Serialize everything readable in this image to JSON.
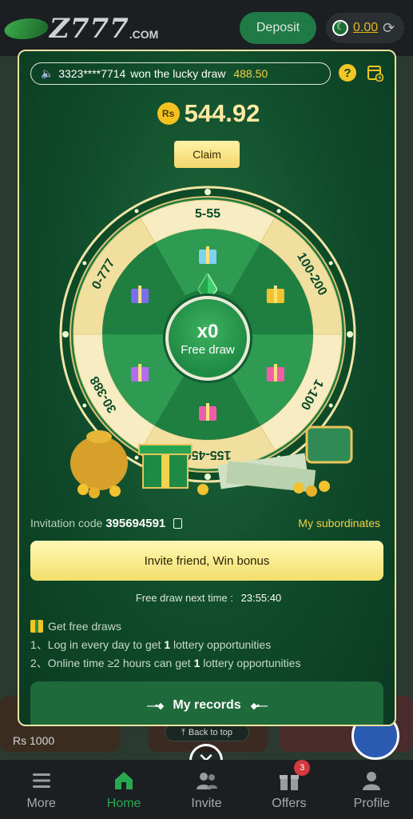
{
  "header": {
    "logo_text": "Z777",
    "logo_suffix": ".COM",
    "deposit_label": "Deposit",
    "balance": "0.00"
  },
  "ticker": {
    "user": "3323****7714",
    "message": "won the lucky draw",
    "amount": "488.50"
  },
  "prize": {
    "currency_icon": "Rs",
    "amount": "544.92",
    "claim_label": "Claim"
  },
  "wheel": {
    "segments": [
      "5-55",
      "100-200",
      "1-100",
      "155-450",
      "30-388",
      "0-777"
    ],
    "center_count": "x0",
    "center_label": "Free draw",
    "colors": {
      "segment_light": "#2f9b52",
      "segment_dark": "#1f7f40",
      "rim": "#f4e2a2"
    }
  },
  "invite": {
    "code_label": "Invitation code",
    "code": "395694591",
    "subordinates_label": "My subordinates",
    "button_label": "Invite friend, Win bonus"
  },
  "next_draw": {
    "label": "Free draw next time :",
    "time": "23:55:40"
  },
  "rules": {
    "title": "Get free draws",
    "items": [
      {
        "prefix": "1、Log in every day to get",
        "count": "1",
        "suffix": "lottery opportunities"
      },
      {
        "prefix": "2、Online time ≥2 hours can get",
        "count": "1",
        "suffix": "lottery opportunities"
      }
    ]
  },
  "records_label": "My records",
  "background": {
    "rs_label": "Rs 1000",
    "back_to_top": "Back to top"
  },
  "nav": {
    "items": [
      {
        "label": "More",
        "icon": "menu-icon"
      },
      {
        "label": "Home",
        "icon": "home-icon"
      },
      {
        "label": "Invite",
        "icon": "invite-icon"
      },
      {
        "label": "Offers",
        "icon": "gift-icon",
        "badge": "3"
      },
      {
        "label": "Profile",
        "icon": "profile-icon"
      }
    ]
  },
  "colors": {
    "accent_green": "#2aa84f",
    "gold": "#f1d24a",
    "modal_green": "#0f4a2a"
  }
}
